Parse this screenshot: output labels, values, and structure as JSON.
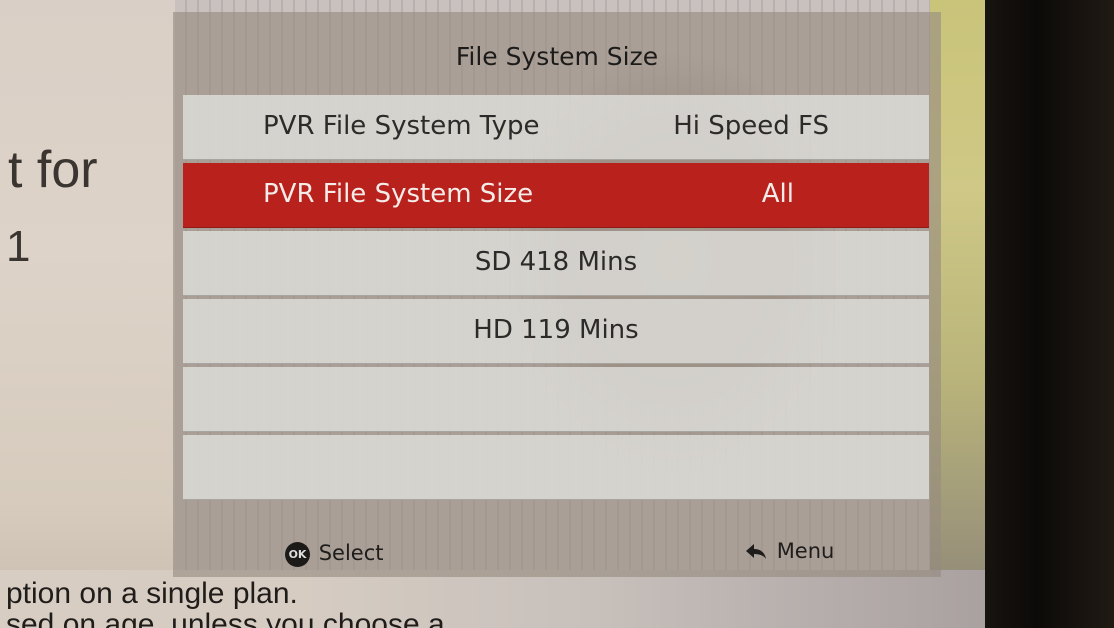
{
  "background": {
    "partial_text_1": "t for",
    "partial_text_2": "1",
    "bottom_line_1": "ption on a single plan.",
    "bottom_line_2": "sed on age, unless you choose a"
  },
  "menu": {
    "title": "File System Size",
    "rows": [
      {
        "label": "PVR File System Type",
        "value": "Hi Speed FS"
      },
      {
        "label": "PVR File System Size",
        "value": "All",
        "selected": true
      },
      {
        "text": "SD 418 Mins"
      },
      {
        "text": "HD 119 Mins"
      },
      {
        "text": ""
      },
      {
        "text": ""
      }
    ],
    "footer": {
      "ok_icon_text": "OK",
      "select_label": "Select",
      "menu_label": "Menu"
    }
  },
  "colors": {
    "selected_row": "#b8211c",
    "row_background": "#e2e2de"
  }
}
